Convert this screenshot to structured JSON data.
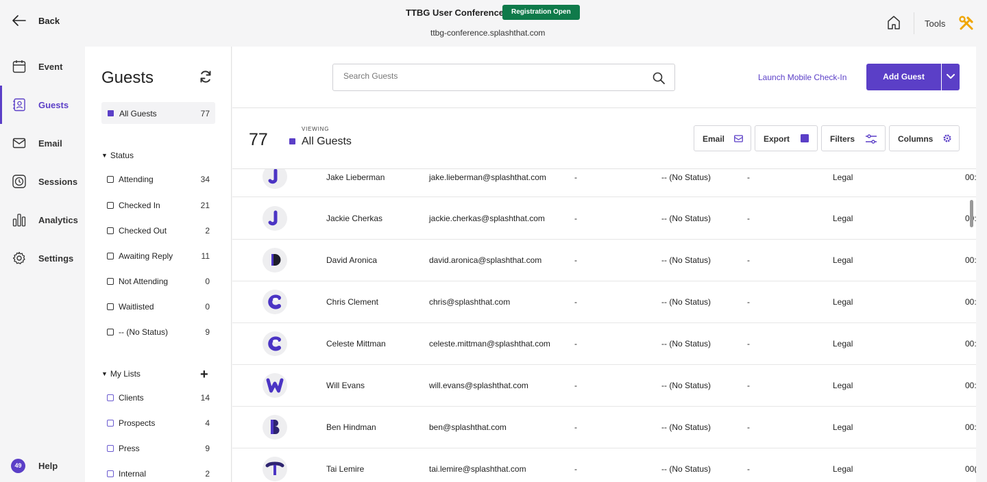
{
  "topbar": {
    "back_label": "Back",
    "event_title": "TTBG User Conference",
    "registration_badge": "Registration Open",
    "event_url": "ttbg-conference.splashthat.com",
    "tools_label": "Tools"
  },
  "nav": {
    "items": [
      {
        "label": "Event",
        "icon": "calendar-icon"
      },
      {
        "label": "Guests",
        "icon": "contacts-icon",
        "active": true
      },
      {
        "label": "Email",
        "icon": "envelope-icon"
      },
      {
        "label": "Sessions",
        "icon": "clock-icon"
      },
      {
        "label": "Analytics",
        "icon": "bar-chart-icon"
      },
      {
        "label": "Settings",
        "icon": "gear-icon"
      }
    ],
    "help_count": "49",
    "help_label": "Help"
  },
  "guests_panel": {
    "title": "Guests",
    "all_guests_label": "All Guests",
    "all_guests_count": "77",
    "status_header": "Status",
    "status_filters": [
      {
        "label": "Attending",
        "count": "34"
      },
      {
        "label": "Checked In",
        "count": "21"
      },
      {
        "label": "Checked Out",
        "count": "2"
      },
      {
        "label": "Awaiting Reply",
        "count": "11"
      },
      {
        "label": "Not Attending",
        "count": "0"
      },
      {
        "label": "Waitlisted",
        "count": "0"
      },
      {
        "label": "-- (No Status)",
        "count": "9"
      }
    ],
    "lists_header": "My Lists",
    "lists": [
      {
        "label": "Clients",
        "count": "14"
      },
      {
        "label": "Prospects",
        "count": "4"
      },
      {
        "label": "Press",
        "count": "9"
      },
      {
        "label": "Internal",
        "count": "2"
      }
    ]
  },
  "main": {
    "search_placeholder": "Search Guests",
    "launch_checkin": "Launch Mobile Check-In",
    "add_guest": "Add Guest",
    "count": "77",
    "viewing_label": "VIEWING",
    "viewing_name": "All Guests",
    "actions": {
      "email": "Email",
      "export": "Export",
      "filters": "Filters",
      "columns": "Columns"
    },
    "accent": "#5b3fc7",
    "badge_color": "#0f7a4a"
  },
  "guests": [
    {
      "name": "Jake Lieberman",
      "email": "jake.lieberman@splashthat.com",
      "d1": "-",
      "status": "-- (No Status)",
      "d2": "-",
      "tag": "Legal",
      "time": "00:",
      "avatar": "J"
    },
    {
      "name": "Jackie Cherkas",
      "email": "jackie.cherkas@splashthat.com",
      "d1": "-",
      "status": "-- (No Status)",
      "d2": "-",
      "tag": "Legal",
      "time": "00:",
      "avatar": "J"
    },
    {
      "name": "David Aronica",
      "email": "david.aronica@splashthat.com",
      "d1": "-",
      "status": "-- (No Status)",
      "d2": "-",
      "tag": "Legal",
      "time": "00:",
      "avatar": "D"
    },
    {
      "name": "Chris Clement",
      "email": "chris@splashthat.com",
      "d1": "-",
      "status": "-- (No Status)",
      "d2": "-",
      "tag": "Legal",
      "time": "00:",
      "avatar": "C"
    },
    {
      "name": "Celeste Mittman",
      "email": "celeste.mittman@splashthat.com",
      "d1": "-",
      "status": "-- (No Status)",
      "d2": "-",
      "tag": "Legal",
      "time": "00:",
      "avatar": "C"
    },
    {
      "name": "Will Evans",
      "email": "will.evans@splashthat.com",
      "d1": "-",
      "status": "-- (No Status)",
      "d2": "-",
      "tag": "Legal",
      "time": "00:",
      "avatar": "W"
    },
    {
      "name": "Ben Hindman",
      "email": "ben@splashthat.com",
      "d1": "-",
      "status": "-- (No Status)",
      "d2": "-",
      "tag": "Legal",
      "time": "00:",
      "avatar": "B"
    },
    {
      "name": "Tai Lemire",
      "email": "tai.lemire@splashthat.com",
      "d1": "-",
      "status": "-- (No Status)",
      "d2": "-",
      "tag": "Legal",
      "time": "00(",
      "avatar": "T"
    }
  ]
}
